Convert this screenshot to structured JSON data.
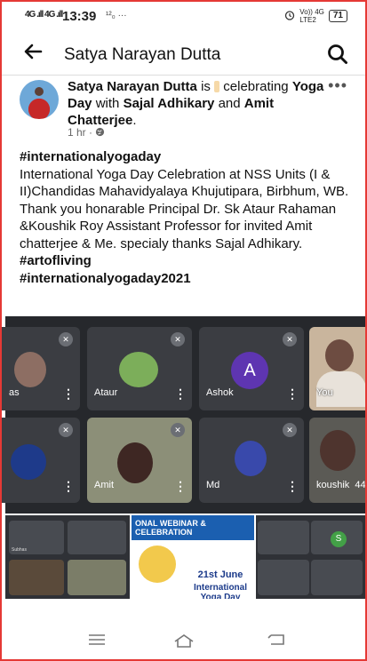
{
  "status_bar": {
    "signal": "4G .ıll 4G .ıll",
    "time": "13:39",
    "extras": "¹²₀ ···",
    "alarm_icon": "alarm-icon",
    "network": "Vo)) 4G",
    "network_sub": "LTE2",
    "battery": "71"
  },
  "top_bar": {
    "title": "Satya Narayan Dutta"
  },
  "post": {
    "author": "Satya Narayan Dutta",
    "is_text": "is",
    "celebrating": "celebrating",
    "event": "Yoga Day",
    "with_text": "with",
    "tag1": "Sajal Adhikary",
    "and_text": "and",
    "tag2": "Amit Chatterjee",
    "period": ".",
    "time": "1 hr",
    "visibility_icon": "globe-icon",
    "hashtag1": "#internationalyogaday",
    "text1": "International Yoga Day Celebration at NSS Units (I & II)Chandidas Mahavidyalaya Khujutipara, Birbhum, WB.",
    "text2": "Thank you honarable Principal Dr. Sk Ataur Rahaman &Koushik Roy Assistant Professor for invited Amit chatterjee & Me. specialy thanks Sajal Adhikary.",
    "hashtag2": "#artofliving",
    "hashtag3": "#internationalyogaday2021"
  },
  "meeting_tiles": [
    {
      "name": "as"
    },
    {
      "name": "Ataur"
    },
    {
      "name": "Ashok",
      "initial": "A"
    },
    {
      "name": "You"
    },
    {
      "name": ""
    },
    {
      "name": "Amit"
    },
    {
      "name": "Md"
    },
    {
      "name": "koushik",
      "extra": "44"
    }
  ],
  "poster": {
    "header": "ONAL WEBINAR & CELEBRATION",
    "date": "21st June",
    "event": "International Yoga Day"
  },
  "gallery_small": {
    "s_initial": "S"
  }
}
